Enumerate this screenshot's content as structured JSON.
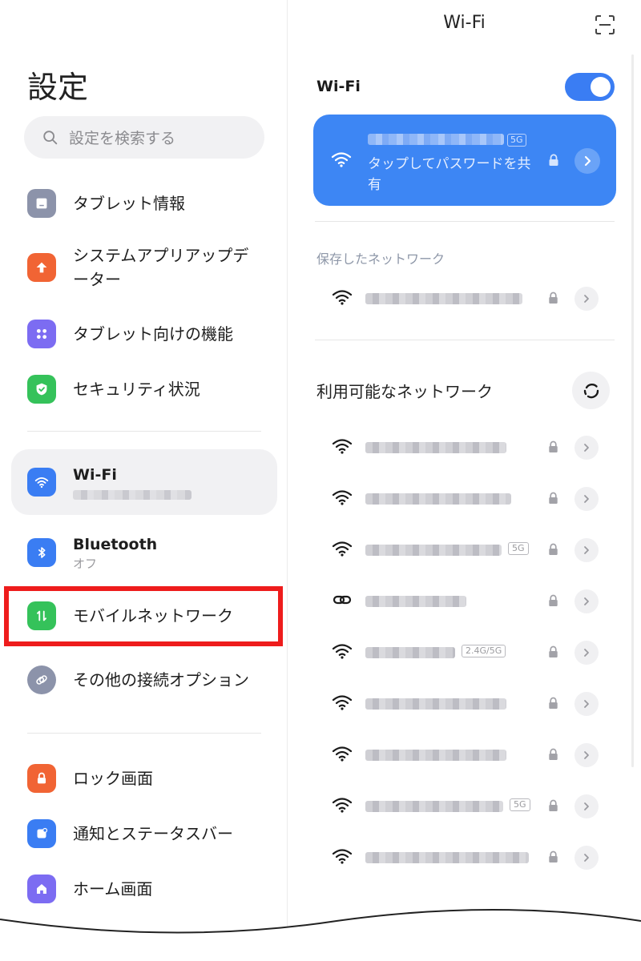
{
  "left": {
    "title": "設定",
    "search_placeholder": "設定を検索する",
    "items": [
      {
        "label": "タブレット情報",
        "icon": "tablet-icon",
        "color": "#8c93aa"
      },
      {
        "label": "システムアプリアップデーター",
        "icon": "arrow-up-icon",
        "color": "#f16434"
      },
      {
        "label": "タブレット向けの機能",
        "icon": "grid-dots-icon",
        "color": "#7c6cf2"
      },
      {
        "label": "セキュリティ状況",
        "icon": "shield-check-icon",
        "color": "#35c25a"
      },
      {
        "label": "Wi-Fi",
        "icon": "wifi-icon",
        "color": "#3a7df3"
      },
      {
        "label": "Bluetooth",
        "sub": "オフ",
        "icon": "bluetooth-icon",
        "color": "#3a7df3"
      },
      {
        "label": "モバイルネットワーク",
        "icon": "mobile-data-icon",
        "color": "#35c25a"
      },
      {
        "label": "その他の接続オプション",
        "icon": "link-icon",
        "color": "#8c93aa"
      },
      {
        "label": "ロック画面",
        "icon": "lock-icon",
        "color": "#f16434"
      },
      {
        "label": "通知とステータスバー",
        "icon": "notification-icon",
        "color": "#3a7df3"
      },
      {
        "label": "ホーム画面",
        "icon": "home-icon",
        "color": "#7c6cf2"
      }
    ]
  },
  "right": {
    "title": "Wi-Fi",
    "wifi_label": "Wi-Fi",
    "wifi_on": true,
    "connected": {
      "band": "5G",
      "share_text": "タップしてパスワードを共有"
    },
    "saved_caption": "保存したネットワーク",
    "available_title": "利用可能なネットワーク",
    "available_bands": [
      "",
      "",
      "5G",
      "",
      "2.4G/5G",
      "",
      "",
      "5G",
      ""
    ]
  },
  "colors": {
    "accent": "#3a7df3",
    "highlight": "#ee1c1c"
  }
}
